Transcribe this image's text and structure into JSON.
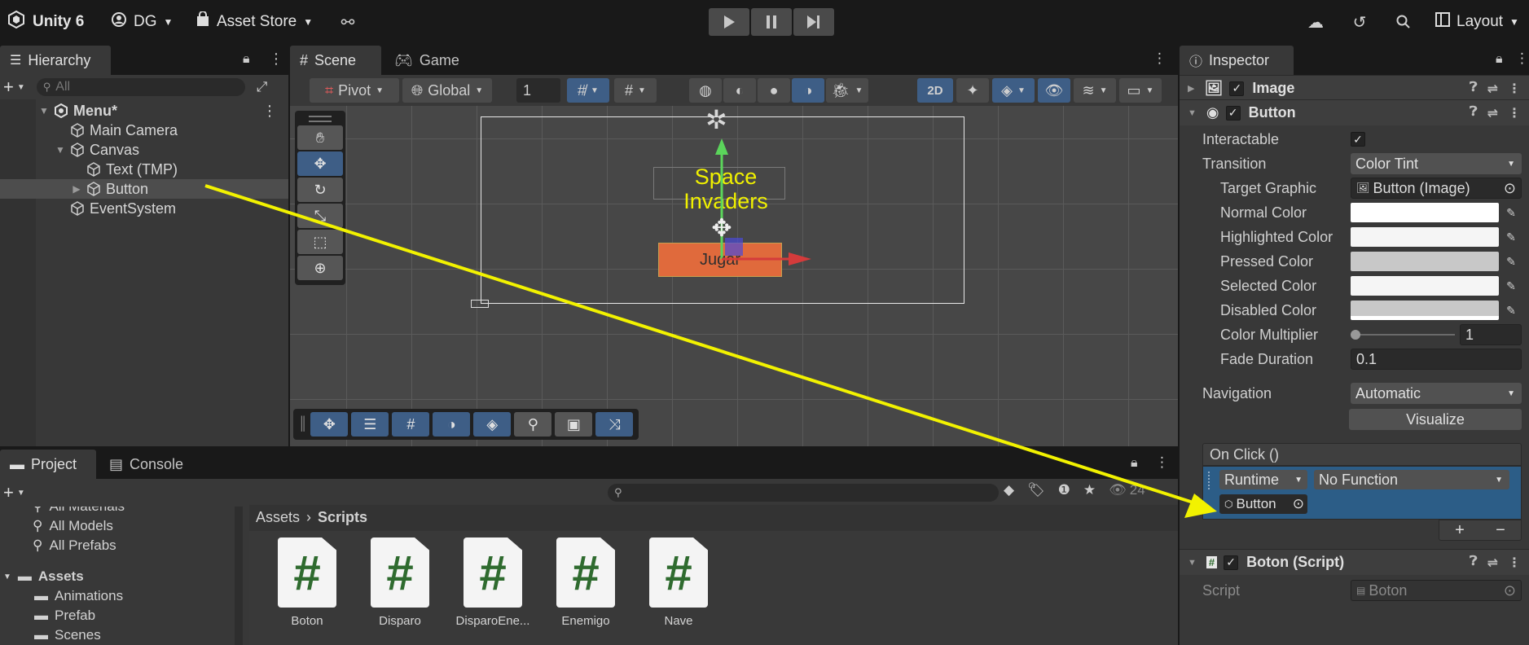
{
  "topbar": {
    "app_name": "Unity 6",
    "account": "DG",
    "asset_store": "Asset Store",
    "layout": "Layout"
  },
  "hierarchy": {
    "tab": "Hierarchy",
    "search_placeholder": "All",
    "items": [
      {
        "label": "Menu*",
        "depth": 0
      },
      {
        "label": "Main Camera",
        "depth": 1
      },
      {
        "label": "Canvas",
        "depth": 1
      },
      {
        "label": "Text (TMP)",
        "depth": 2
      },
      {
        "label": "Button",
        "depth": 2
      },
      {
        "label": "EventSystem",
        "depth": 1
      }
    ]
  },
  "scene": {
    "tabs": [
      "Scene",
      "Game"
    ],
    "pivot": "Pivot",
    "global": "Global",
    "grid_value": "1",
    "mode_2d": "2D",
    "title_text": "Space Invaders",
    "button_text": "Jugar"
  },
  "inspector": {
    "tab": "Inspector",
    "components": {
      "image": "Image",
      "button": "Button",
      "script": "Boton (Script)"
    },
    "fields": {
      "interactable": "Interactable",
      "transition": "Transition",
      "transition_value": "Color Tint",
      "target_graphic": "Target Graphic",
      "target_graphic_value": "Button (Image)",
      "normal_color": "Normal Color",
      "highlighted_color": "Highlighted Color",
      "pressed_color": "Pressed Color",
      "selected_color": "Selected Color",
      "disabled_color": "Disabled Color",
      "color_multiplier": "Color Multiplier",
      "color_multiplier_value": "1",
      "fade_duration": "Fade Duration",
      "fade_duration_value": "0.1",
      "navigation": "Navigation",
      "navigation_value": "Automatic",
      "visualize": "Visualize",
      "on_click": "On Click ()",
      "runtime": "Runtime",
      "no_function": "No Function",
      "object_ref": "Button",
      "script_label": "Script",
      "script_value": "Boton"
    },
    "colors": {
      "normal": "#ffffff",
      "highlighted": "#f5f5f5",
      "pressed": "#c8c8c8",
      "selected": "#f5f5f5",
      "disabled": "#c8c8c8"
    }
  },
  "project": {
    "tabs": [
      "Project",
      "Console"
    ],
    "count": "24",
    "favorites": [
      "All Materials",
      "All Models",
      "All Prefabs"
    ],
    "tree_root": "Assets",
    "tree_children": [
      "Animations",
      "Prefab",
      "Scenes"
    ],
    "breadcrumb": [
      "Assets",
      "Scripts"
    ],
    "assets": [
      "Boton",
      "Disparo",
      "DisparoEne...",
      "Enemigo",
      "Nave"
    ]
  }
}
